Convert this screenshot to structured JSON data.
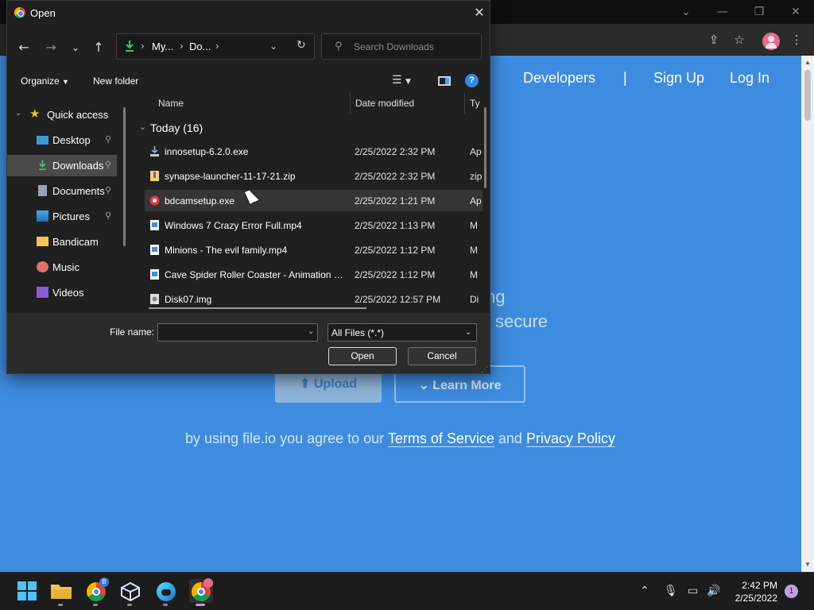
{
  "browser": {
    "window_controls": [
      "⌄",
      "—",
      "❐",
      "✕"
    ],
    "toolbar_icons": [
      "share-icon",
      "star-icon",
      "profile-icon",
      "menu-icon"
    ]
  },
  "site": {
    "nav": {
      "developers": "Developers",
      "divider": "|",
      "signup": "Sign Up",
      "login": "Log In"
    },
    "hero_line1_tail": "ng",
    "hero_line2_tail": "secure",
    "upload_label": "Upload",
    "learn_more_label": "Learn More",
    "consent": {
      "prefix": "by using file.io you agree to our",
      "terms": "Terms of Service",
      "and": "and",
      "privacy": "Privacy Policy"
    },
    "accent": "#3d8ce0"
  },
  "dialog": {
    "title": "Open",
    "close_glyph": "✕",
    "breadcrumb": [
      "My...",
      "Do..."
    ],
    "search_placeholder": "Search Downloads",
    "organize_label": "Organize",
    "new_folder_label": "New folder",
    "help_glyph": "?",
    "nav_items": [
      {
        "label": "Quick access",
        "icon": "star-icon"
      },
      {
        "label": "Desktop",
        "icon": "desktop-icon",
        "pinned": true
      },
      {
        "label": "Downloads",
        "icon": "download-icon",
        "pinned": true,
        "selected": true
      },
      {
        "label": "Documents",
        "icon": "documents-icon",
        "pinned": true
      },
      {
        "label": "Pictures",
        "icon": "pictures-icon",
        "pinned": true
      },
      {
        "label": "Bandicam",
        "icon": "folder-icon"
      },
      {
        "label": "Music",
        "icon": "music-icon"
      },
      {
        "label": "Videos",
        "icon": "videos-icon"
      }
    ],
    "columns": {
      "name": "Name",
      "date": "Date modified",
      "type": "Ty"
    },
    "group_label": "Today (16)",
    "files": [
      {
        "name": "innosetup-6.2.0.exe",
        "date": "2/25/2022 2:32 PM",
        "type": "Ap",
        "icon": "installer-icon"
      },
      {
        "name": "synapse-launcher-11-17-21.zip",
        "date": "2/25/2022 2:32 PM",
        "type": "zip",
        "icon": "zip-icon"
      },
      {
        "name": "bdcamsetup.exe",
        "date": "2/25/2022 1:21 PM",
        "type": "Ap",
        "icon": "bandicam-icon"
      },
      {
        "name": "Windows 7 Crazy Error Full.mp4",
        "date": "2/25/2022 1:13 PM",
        "type": "M",
        "icon": "video-file-icon"
      },
      {
        "name": "Minions - The evil family.mp4",
        "date": "2/25/2022 1:12 PM",
        "type": "M",
        "icon": "video-file-icon"
      },
      {
        "name": "Cave Spider Roller Coaster - Animation v...",
        "date": "2/25/2022 1:12 PM",
        "type": "M",
        "icon": "video-file-icon"
      },
      {
        "name": "Disk07.img",
        "date": "2/25/2022 12:57 PM",
        "type": "Di",
        "icon": "disk-image-icon"
      }
    ],
    "file_name_label": "File name:",
    "file_name_value": "",
    "filter_value": "All Files (*.*)",
    "open_label": "Open",
    "cancel_label": "Cancel"
  },
  "taskbar": {
    "apps": [
      "start-icon",
      "file-explorer-icon",
      "chrome-beta-icon",
      "virtualbox-icon",
      "edge-beta-icon",
      "chrome-canary-icon"
    ],
    "chrome_badge": "B",
    "time": "2:42 PM",
    "date": "2/25/2022",
    "notifications": "1"
  }
}
